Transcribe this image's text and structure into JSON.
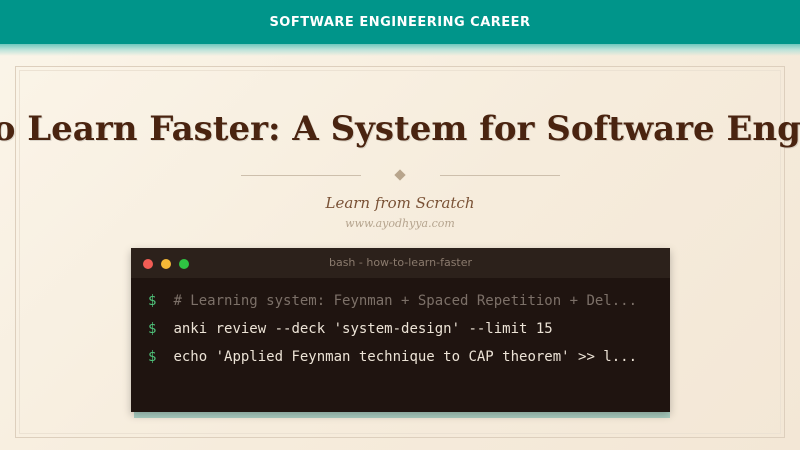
{
  "banner": {
    "label": "SOFTWARE ENGINEERING CAREER"
  },
  "article": {
    "title": "How to Learn Faster: A System for Software Engineers",
    "subtitle": "Learn from Scratch",
    "site": "www.ayodhyya.com"
  },
  "terminal": {
    "title": "bash - how-to-learn-faster",
    "prompt": "$",
    "lines": [
      {
        "text": "# Learning system: Feynman + Spaced Repetition + Del..."
      },
      {
        "text": "anki review --deck 'system-design' --limit 15"
      },
      {
        "text": "echo 'Applied Feynman technique to CAP theorem' >> l..."
      }
    ]
  },
  "colors": {
    "banner": "#00958a",
    "title": "#4a2410",
    "terminal_bg": "#1f1410",
    "prompt": "#4fc27a"
  }
}
